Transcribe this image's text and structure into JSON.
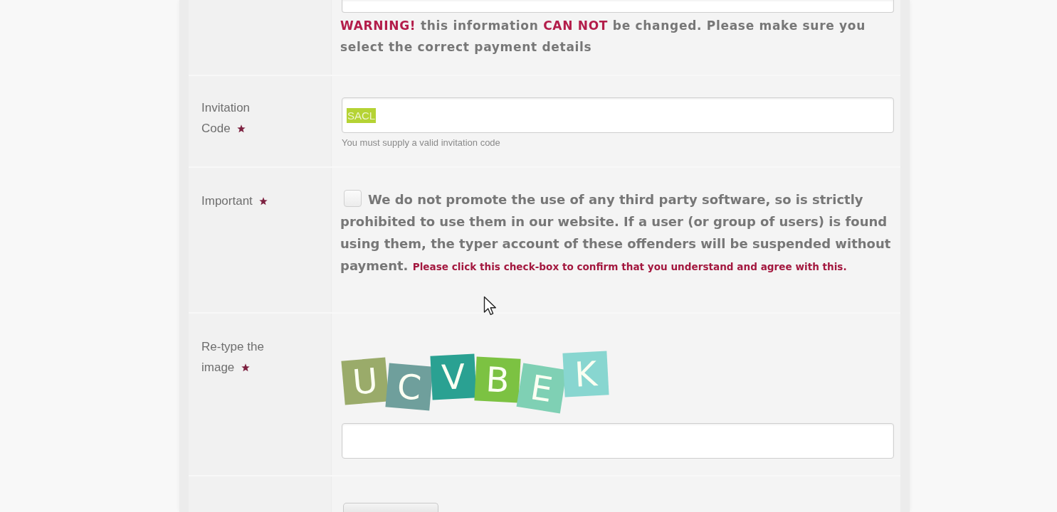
{
  "rows": [
    {
      "kind": "warning_field",
      "warning": "**WARNING!** this information **CAN NOT** be changed. Please make sure you select the correct payment details"
    },
    {
      "kind": "text_field",
      "label": "Invitation Code",
      "required": true,
      "value": "SACL",
      "value_selected": true,
      "hint": "You must supply a valid invitation code"
    },
    {
      "kind": "agreement",
      "label": "Important",
      "required": true,
      "checked": false,
      "text": "We do not promote the use of any third party software, so is strictly prohibited to use them in our website. If a user (or group of users) is found using them, the typer account of these offenders will be suspended without payment. **Please click this check-box to confirm that you understand and agree with this.**"
    },
    {
      "kind": "captcha",
      "label": "Re-type the image",
      "required": true,
      "captcha": [
        {
          "char": "U",
          "color": "#9aab6a"
        },
        {
          "char": "C",
          "color": "#6f9f9c"
        },
        {
          "char": "V",
          "color": "#2aa192"
        },
        {
          "char": "B",
          "color": "#7cc242"
        },
        {
          "char": "E",
          "color": "#7fd0b4"
        },
        {
          "char": "K",
          "color": "#88d6d0"
        }
      ]
    },
    {
      "kind": "button_row"
    }
  ]
}
